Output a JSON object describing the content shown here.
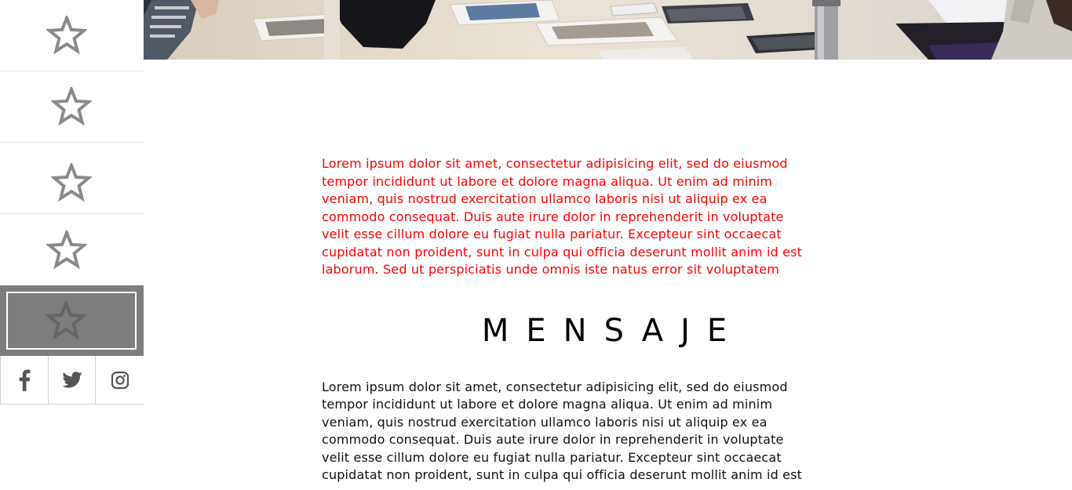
{
  "sidebar": {
    "items": [
      {
        "icon": "star-icon"
      },
      {
        "icon": "star-icon"
      },
      {
        "icon": "star-icon"
      },
      {
        "icon": "star-icon"
      },
      {
        "icon": "star-icon",
        "active": true
      }
    ],
    "social": [
      {
        "icon": "facebook-icon"
      },
      {
        "icon": "twitter-icon"
      },
      {
        "icon": "instagram-icon"
      }
    ]
  },
  "main": {
    "intro": "Lorem ipsum dolor sit amet, consectetur adipisicing elit, sed do eiusmod\ntempor incididunt ut labore et dolore magna aliqua. Ut enim ad minim\nveniam, quis nostrud exercitation ullamco laboris nisi ut aliquip ex ea\ncommodo consequat. Duis aute irure dolor in reprehenderit in voluptate\nvelit esse cillum dolore eu fugiat nulla pariatur. Excepteur sint occaecat\ncupidatat non proident, sunt in culpa qui officia deserunt mollit anim id est\nlaborum. Sed ut perspiciatis unde omnis iste natus error sit voluptatem",
    "heading": "MENSAJE",
    "body": "Lorem ipsum dolor sit amet, consectetur adipisicing elit, sed do eiusmod\ntempor incididunt ut labore et dolore magna aliqua. Ut enim ad minim\nveniam, quis nostrud exercitation ullamco laboris nisi ut aliquip ex ea\ncommodo consequat. Duis aute irure dolor in reprehenderit in voluptate\nvelit esse cillum dolore eu fugiat nulla pariatur. Excepteur sint occaecat\ncupidatat non proident, sunt in culpa qui officia deserunt mollit anim id est"
  },
  "colors": {
    "intro_text": "#ff0000",
    "body_text": "#111111",
    "active_nav_bg": "#7d7d7d",
    "icon_gray": "#8a8a8a"
  }
}
